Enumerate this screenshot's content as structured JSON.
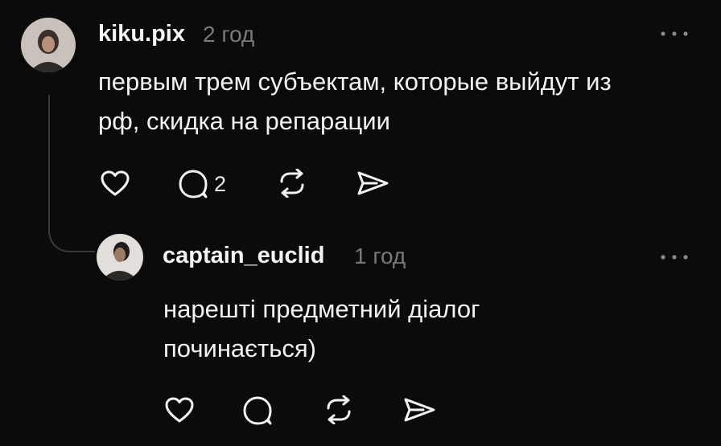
{
  "comments": [
    {
      "username": "kiku.pix",
      "time": "2 год",
      "text_lines": [
        "первым трем субъектам, которые выйдут из",
        "рф, скидка на репарации"
      ],
      "reply_count": "2",
      "icons": [
        "heart-icon",
        "comment-icon",
        "repost-icon",
        "share-icon",
        "more-icon"
      ]
    },
    {
      "username": "captain_euclid",
      "time": "1 год",
      "text_lines": [
        "нарешті предметний діалог",
        "починається)"
      ],
      "icons": [
        "heart-icon",
        "comment-icon",
        "repost-icon",
        "share-icon",
        "more-icon"
      ]
    }
  ],
  "colors": {
    "background": "#0b0b0b",
    "text": "#f3f3f3",
    "muted": "#7a7a7a",
    "thread_line": "#3a3a3a"
  }
}
